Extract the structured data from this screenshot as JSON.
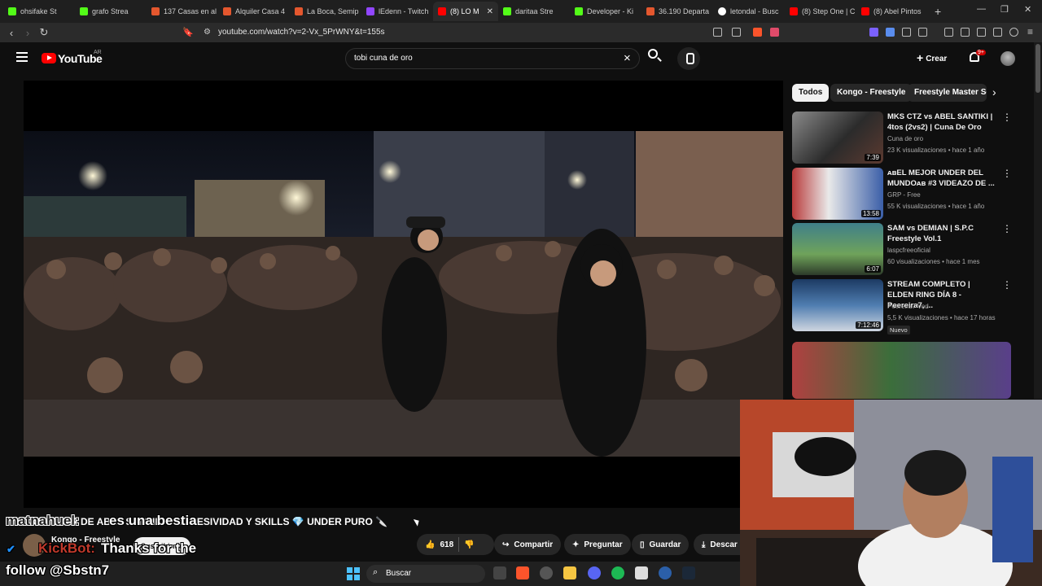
{
  "browser": {
    "tabs": [
      {
        "label": "ohsifake St"
      },
      {
        "label": "grafo Strea"
      },
      {
        "label": "137 Casas en al"
      },
      {
        "label": "Alquiler Casa 4"
      },
      {
        "label": "La Boca, Semip"
      },
      {
        "label": "lEdenn - Twitch"
      },
      {
        "label": "(8) LO M"
      },
      {
        "label": "daritaa Stre"
      },
      {
        "label": "Developer - Ki"
      },
      {
        "label": "36.190 Departa"
      },
      {
        "label": "letondal - Busc"
      },
      {
        "label": "(8) Step One | C"
      },
      {
        "label": "(8) Abel Pintos"
      }
    ],
    "url": "youtube.com/watch?v=2-Vx_5PrWNY&t=155s"
  },
  "youtube": {
    "logo_text": "YouTube",
    "country": "AR",
    "search_query": "tobi cuna de oro",
    "create_label": "Crear",
    "notification_count": "9+",
    "video_title": "LO MEJOR DE ABEL SANTIKI – AGRESIVIDAD Y SKILLS 💎 UNDER PURO 🔪",
    "channel_name": "Kongo - Freestyle",
    "subscribe_label": "Suscribirme",
    "like_count": "618",
    "share_label": "Compartir",
    "ask_label": "Preguntar",
    "save_label": "Guardar",
    "download_label": "Descar"
  },
  "sidebar": {
    "chips": [
      {
        "label": "Todos"
      },
      {
        "label": "Kongo - Freestyle"
      },
      {
        "label": "Freestyle Master Se"
      }
    ],
    "recommendations": [
      {
        "title": "MKS CTZ vs ABEL SANTIKI | 4tos (2vs2) | Cuna De Oro",
        "channel": "Cuna de oro",
        "meta": "23 K visualizaciones • hace 1 año",
        "duration": "7:39",
        "badge": ""
      },
      {
        "title": "ᴀʙEL MEJOR UNDER DEL MUNDOᴀʙ #3 VIDEAZO DE ...",
        "channel": "GRP - Free",
        "meta": "55 K visualizaciones • hace 1 año",
        "duration": "13:58",
        "badge": ""
      },
      {
        "title": "SAM vs DEMIAN | S.P.C Freestyle Vol.1",
        "channel": "laspcfreeoficial",
        "meta": "60 visualizaciones • hace 1 mes",
        "duration": "6:07",
        "badge": ""
      },
      {
        "title": "STREAM COMPLETO | ELDEN RING DÍA 8 - Peereira7, ...",
        "channel": "Peereira7 Vod",
        "meta": "5,5 K visualizaciones • hace 17 horas",
        "duration": "7:12:46",
        "badge": "Nuevo"
      }
    ]
  },
  "overlay": {
    "chat_user": "matnahuel:",
    "chat_message": "es una bestia",
    "bot_name": "KickBot:",
    "bot_message": "Thanks for the",
    "follow_text": "follow @Sbstn7"
  },
  "taskbar": {
    "search_label": "Buscar"
  },
  "colors": {
    "youtube_red": "#ff0000",
    "chat_user": "#1e1e1e",
    "bot_name": "#c0392b",
    "windows_blue": "#4cc2ff"
  }
}
